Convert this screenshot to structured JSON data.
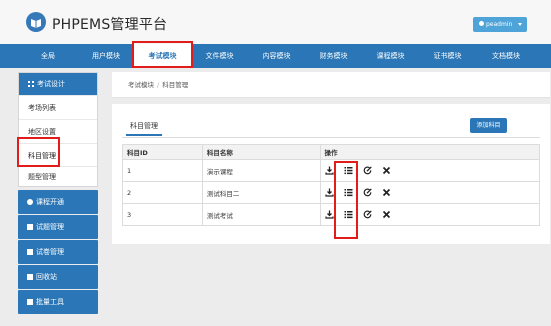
{
  "header": {
    "site_title": "PHPEMS管理平台",
    "user_label": "peadmin",
    "logo_icon": "book-logo",
    "accent": "#2a76b6"
  },
  "nav": {
    "items": [
      {
        "label": "全局",
        "active": false
      },
      {
        "label": "用户模块",
        "active": false
      },
      {
        "label": "考试模块",
        "active": true
      },
      {
        "label": "文件模块",
        "active": false
      },
      {
        "label": "内容模块",
        "active": false
      },
      {
        "label": "财务模块",
        "active": false
      },
      {
        "label": "课程模块",
        "active": false
      },
      {
        "label": "证书模块",
        "active": false
      },
      {
        "label": "文档模块",
        "active": false
      }
    ]
  },
  "sidebar": {
    "group_title": "考试设计",
    "links": [
      "考场列表",
      "地区设置",
      "科目管理",
      "题型管理"
    ],
    "current": "科目管理",
    "buttons": [
      "课程开通",
      "试题管理",
      "试卷管理",
      "回收站",
      "批量工具"
    ]
  },
  "breadcrumb": {
    "root": "考试模块",
    "separator": "/",
    "current": "科目管理"
  },
  "main": {
    "tab_label": "科目管理",
    "add_button": "添加科目",
    "columns": [
      "科目ID",
      "科目名称",
      "操作"
    ],
    "rows": [
      {
        "id": "1",
        "name": "演示课程"
      },
      {
        "id": "2",
        "name": "测试科目二"
      },
      {
        "id": "3",
        "name": "测试考试"
      }
    ],
    "row_actions": [
      "download-icon",
      "list-icon",
      "edit-icon",
      "delete-icon"
    ]
  },
  "highlight_color": "#e21b1b"
}
